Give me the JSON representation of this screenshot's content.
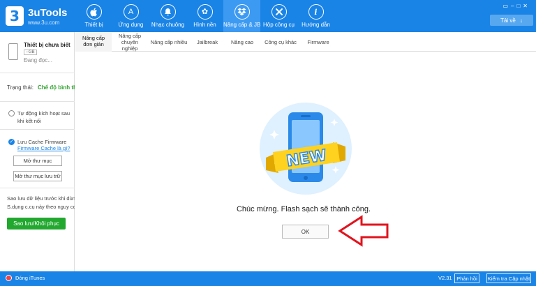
{
  "app": {
    "title": "3uTools",
    "subtitle": "www.3u.com",
    "logo_glyph": "3",
    "accent": "#1a84e6",
    "download_label": "Tải về",
    "download_icon": "download-arrow-icon"
  },
  "nav": [
    {
      "id": "device",
      "label": "Thiết bị",
      "icon": "apple-icon",
      "glyph": ""
    },
    {
      "id": "apps",
      "label": "Ứng dụng",
      "icon": "app-store-icon",
      "glyph": "A"
    },
    {
      "id": "ringtones",
      "label": "Nhạc chuông",
      "icon": "bell-icon",
      "glyph": "♪"
    },
    {
      "id": "wallpapers",
      "label": "Hình nền",
      "icon": "flower-icon",
      "glyph": "✿"
    },
    {
      "id": "flash",
      "label": "Nâng cấp & JB",
      "icon": "dropbox-icon",
      "glyph": "◈",
      "active": true
    },
    {
      "id": "toolbox",
      "label": "Hộp công cụ",
      "icon": "tools-icon",
      "glyph": "✕"
    },
    {
      "id": "guide",
      "label": "Hướng dẫn",
      "icon": "info-icon",
      "glyph": "i"
    }
  ],
  "sidebar": {
    "device_name": "Thiết bị chưa biết",
    "device_capacity": "--GB",
    "device_status": "Đang đọc...",
    "state_label": "Trạng thái:",
    "state_value": "Chế độ bình thường",
    "auto_activate_line1": "Tự động kích hoạt sau",
    "auto_activate_line2": "khi kết nối",
    "cache_firmware": "Lưu Cache Firmware",
    "cache_link": "Firmware Cache là gì?",
    "open_folder": "Mở thư mục",
    "open_backup_folder": "Mở thư mục lưu trữ",
    "backup_note_line1": "Sao lưu dữ liệu trước khi dùng",
    "backup_note_line2": "S.dụng c.cụ này theo nguy cơ cá nhân",
    "backup_button": "Sao lưu/Khôi phục"
  },
  "tabs": [
    {
      "id": "easy",
      "label_line1": "Nâng cấp",
      "label_line2": "đơn giản",
      "active": true
    },
    {
      "id": "pro",
      "label_line1": "Nâng cấp chuyên",
      "label_line2": "nghiệp"
    },
    {
      "id": "multi",
      "label_line1": "Nâng cấp nhiều",
      "label_line2": ""
    },
    {
      "id": "jailbreak",
      "label_line1": "Jailbreak",
      "label_line2": ""
    },
    {
      "id": "advanced",
      "label_line1": "Nâng cao",
      "label_line2": ""
    },
    {
      "id": "other",
      "label_line1": "Công cụ khác",
      "label_line2": ""
    },
    {
      "id": "firmware",
      "label_line1": "Firmware",
      "label_line2": ""
    }
  ],
  "main": {
    "badge_text": "NEW",
    "message": "Chúc mừng. Flash sạch sẽ thành công.",
    "ok_label": "OK",
    "arrow_color": "#e0141e"
  },
  "footer": {
    "itunes_label": "Đóng iTunes",
    "version": "V2.31",
    "feedback": "Phản hồi",
    "check_update": "Kiểm tra Cập nhật"
  }
}
